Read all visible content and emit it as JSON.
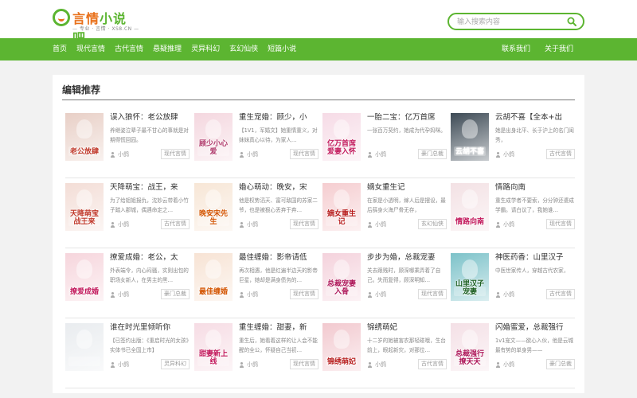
{
  "site": {
    "logo_title_a": "言情",
    "logo_title_b": "小说吧",
    "logo_subtitle": "— 专业 · 言情 · XS8.CN —"
  },
  "search": {
    "placeholder": "输入搜索内容",
    "icon": "search-icon"
  },
  "nav": {
    "left": [
      "首页",
      "现代言情",
      "古代言情",
      "悬疑推理",
      "灵异科幻",
      "玄幻仙侠",
      "短篇小说"
    ],
    "right": [
      "联系我们",
      "关于我们"
    ]
  },
  "section": {
    "title": "编辑推荐"
  },
  "books": [
    [
      {
        "title": "误入狼怀：老公放肆",
        "desc": "养继姿泣辈子最不甘心的事就是对期得慌回园。",
        "author": "小鸽",
        "tag": "现代言情",
        "cover_text": "老公放肆",
        "cover_color": "#e8cfc6",
        "cover_text_color": "#c0392b"
      },
      {
        "title": "重生宠婚：顾少，小",
        "desc": "【1V1，军婚文】她重情重义，对妹妹真心以待，为家人…",
        "author": "小鸽",
        "tag": "现代言情",
        "cover_text": "顾少小心爱",
        "cover_color": "#f4d7df",
        "cover_text_color": "#b03a6b"
      },
      {
        "title": "一胎二宝：亿万首席",
        "desc": "一张百万契约，她成为代孕妈咪。",
        "author": "小鸽",
        "tag": "豪门总裁",
        "cover_text": "亿万首席爱妻入怀",
        "cover_color": "#f6dbe6",
        "cover_text_color": "#c2185b"
      },
      {
        "title": "云胡不喜【全本+出",
        "desc": "她是出身北平、长于沪上的名门闺秀，",
        "author": "小鸽",
        "tag": "古代言情",
        "cover_text": "云胡不喜",
        "cover_color": "#3d4a55",
        "cover_text_color": "#ffffff"
      }
    ],
    [
      {
        "title": "天降萌宝：战王，来",
        "desc": "为了给姐姐报仇，沈妙云带着小竹子踏入郡城，偶遇命定之…",
        "author": "小鸽",
        "tag": "古代言情",
        "cover_text": "天降萌宝战王来",
        "cover_color": "#f3ddd6",
        "cover_text_color": "#c0392b"
      },
      {
        "title": "婚心萌动：晚安，宋",
        "desc": "他是权势滔天、富可敌国的苏家二爷，也是被狠心丢弃于弃…",
        "author": "小鸽",
        "tag": "现代言情",
        "cover_text": "晚安宋先生",
        "cover_color": "#f7e6d6",
        "cover_text_color": "#d35400"
      },
      {
        "title": "嫡女重生记",
        "desc": "在家是小透明，嫁人后是摆设，最后薛身火海尸骨无存，",
        "author": "小鸽",
        "tag": "玄幻仙侠",
        "cover_text": "嫡女重生记",
        "cover_color": "#f5cdd0",
        "cover_text_color": "#b71c1c"
      },
      {
        "title": "情路向南",
        "desc": "重生成学者不要索，分分钟还婆成学霸。请白议了，我她谁…",
        "author": "小鸽",
        "tag": "现代言情",
        "cover_text": "情路向南",
        "cover_color": "#f3e1e4",
        "cover_text_color": "#c2185b"
      }
    ],
    [
      {
        "title": "撩爱成婚：老公，太",
        "desc": "外表端令，内心闷骚，实则出包的职场女新人，在男主的黑…",
        "author": "小鸽",
        "tag": "豪门总裁",
        "cover_text": "撩爱成婚",
        "cover_color": "#f6d5dc",
        "cover_text_color": "#c2185b"
      },
      {
        "title": "最佳缠婚：影帝请低",
        "desc": "再次相遇，他是红遍半边天的影帝巨星，她却是满身债务的…",
        "author": "小鸽",
        "tag": "现代言情",
        "cover_text": "最佳缠婚",
        "cover_color": "#f7e3d4",
        "cover_text_color": "#d35400"
      },
      {
        "title": "步步为婚，总裁宠妻",
        "desc": "关去跟贱时，顾深哪乘弄着了自己。失而复得，顾深明知…",
        "author": "小鸽",
        "tag": "现代言情",
        "cover_text": "总裁宠妻入骨",
        "cover_color": "#f4d2dc",
        "cover_text_color": "#ad1457"
      },
      {
        "title": "神医药香：山里汉子",
        "desc": "中医世家传人，穿越古代农家，",
        "author": "小鸽",
        "tag": "古代言情",
        "cover_text": "山里汉子宠妻",
        "cover_color": "#7cc2c9",
        "cover_text_color": "#1b5e20"
      }
    ],
    [
      {
        "title": "谁在时光里倾听你",
        "desc": "【已签约出版：《重启时光的女孩》实体书已全国上市】",
        "author": "小鸽",
        "tag": "灵异科幻",
        "cover_text": "",
        "cover_color": "#e9ecef",
        "cover_text_color": "#555555"
      },
      {
        "title": "重生缠婚：甜妻，新",
        "desc": "重生后，她看着这样的让人会不能醒的全公，怀疑自己当初…",
        "author": "小鸽",
        "tag": "现代言情",
        "cover_text": "甜妻新上线",
        "cover_color": "#f6dce4",
        "cover_text_color": "#c2185b"
      },
      {
        "title": "锦绣萌妃",
        "desc": "十二岁的她被害农那轻碰哦，生台前上，眼起新灾，对那位…",
        "author": "小鸽",
        "tag": "古代言情",
        "cover_text": "锦绣萌妃",
        "cover_color": "#f2c9cf",
        "cover_text_color": "#b71c1c"
      },
      {
        "title": "闪婚蜜爱，总裁强行",
        "desc": "1v1宠文——欲心入伙，他是云城最有势的单身男——",
        "author": "小鸽",
        "tag": "豪门总裁",
        "cover_text": "总裁强行撩天天",
        "cover_color": "#f4e0e6",
        "cover_text_color": "#ad1457"
      }
    ]
  ]
}
